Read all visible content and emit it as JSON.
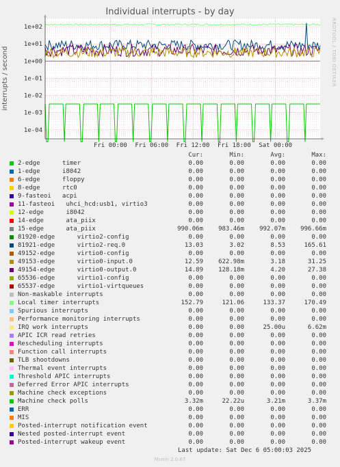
{
  "title": "Individual interrupts - by day",
  "side_label": "RRDTOOL / TOBI OETIKER",
  "ylabel": "interrupts / second",
  "headers": {
    "cur": "Cur:",
    "min": "Min:",
    "avg": "Avg:",
    "max": "Max:"
  },
  "legend": [
    {
      "name": "2-edge      timer",
      "color": "#00cc00",
      "cur": "0.00",
      "min": "0.00",
      "avg": "0.00",
      "max": "0.00"
    },
    {
      "name": "1-edge      i8042",
      "color": "#0066b3",
      "cur": "0.00",
      "min": "0.00",
      "avg": "0.00",
      "max": "0.00"
    },
    {
      "name": "6-edge      floppy",
      "color": "#ff8000",
      "cur": "0.00",
      "min": "0.00",
      "avg": "0.00",
      "max": "0.00"
    },
    {
      "name": "8-edge      rtc0",
      "color": "#ffcc00",
      "cur": "0.00",
      "min": "0.00",
      "avg": "0.00",
      "max": "0.00"
    },
    {
      "name": "9-fasteoi   acpi",
      "color": "#330099",
      "cur": "0.00",
      "min": "0.00",
      "avg": "0.00",
      "max": "0.00"
    },
    {
      "name": "11-fasteoi   uhci_hcd:usb1, virtio3",
      "color": "#990099",
      "cur": "0.00",
      "min": "0.00",
      "avg": "0.00",
      "max": "0.00"
    },
    {
      "name": "12-edge      i8042",
      "color": "#ccff00",
      "cur": "0.00",
      "min": "0.00",
      "avg": "0.00",
      "max": "0.00"
    },
    {
      "name": "14-edge      ata_piix",
      "color": "#ff0000",
      "cur": "0.00",
      "min": "0.00",
      "avg": "0.00",
      "max": "0.00"
    },
    {
      "name": "15-edge      ata_piix",
      "color": "#808080",
      "cur": "990.06m",
      "min": "983.46m",
      "avg": "992.07m",
      "max": "996.66m"
    },
    {
      "name": "81920-edge      virtio2-config",
      "color": "#008f00",
      "cur": "0.00",
      "min": "0.00",
      "avg": "0.00",
      "max": "0.00"
    },
    {
      "name": "81921-edge      virtio2-req.0",
      "color": "#00487d",
      "cur": "13.03",
      "min": "3.02",
      "avg": "8.53",
      "max": "165.61"
    },
    {
      "name": "49152-edge      virtio0-config",
      "color": "#b35a00",
      "cur": "0.00",
      "min": "0.00",
      "avg": "0.00",
      "max": "0.00"
    },
    {
      "name": "49153-edge      virtio0-input.0",
      "color": "#b38f00",
      "cur": "12.59",
      "min": "622.98m",
      "avg": "3.18",
      "max": "31.25"
    },
    {
      "name": "49154-edge      virtio0-output.0",
      "color": "#6b006b",
      "cur": "14.89",
      "min": "128.18m",
      "avg": "4.20",
      "max": "27.38"
    },
    {
      "name": "65536-edge      virtio1-config",
      "color": "#8fb300",
      "cur": "0.00",
      "min": "0.00",
      "avg": "0.00",
      "max": "0.00"
    },
    {
      "name": "65537-edge      virtio1-virtqueues",
      "color": "#b30000",
      "cur": "0.00",
      "min": "0.00",
      "avg": "0.00",
      "max": "0.00"
    },
    {
      "name": "Non-maskable interrupts",
      "color": "#bebebe",
      "cur": "0.00",
      "min": "0.00",
      "avg": "0.00",
      "max": "0.00"
    },
    {
      "name": "Local timer interrupts",
      "color": "#80ff80",
      "cur": "152.79",
      "min": "121.06",
      "avg": "133.37",
      "max": "170.49"
    },
    {
      "name": "Spurious interrupts",
      "color": "#80c9ff",
      "cur": "0.00",
      "min": "0.00",
      "avg": "0.00",
      "max": "0.00"
    },
    {
      "name": "Performance monitoring interrupts",
      "color": "#ffc080",
      "cur": "0.00",
      "min": "0.00",
      "avg": "0.00",
      "max": "0.00"
    },
    {
      "name": "IRQ work interrupts",
      "color": "#ffe680",
      "cur": "0.00",
      "min": "0.00",
      "avg": "25.00u",
      "max": "6.62m"
    },
    {
      "name": "APIC ICR read retries",
      "color": "#aa80ff",
      "cur": "0.00",
      "min": "0.00",
      "avg": "0.00",
      "max": "0.00"
    },
    {
      "name": "Rescheduling interrupts",
      "color": "#ee00cc",
      "cur": "0.00",
      "min": "0.00",
      "avg": "0.00",
      "max": "0.00"
    },
    {
      "name": "Function call interrupts",
      "color": "#ff8080",
      "cur": "0.00",
      "min": "0.00",
      "avg": "0.00",
      "max": "0.00"
    },
    {
      "name": "TLB shootdowns",
      "color": "#666600",
      "cur": "0.00",
      "min": "0.00",
      "avg": "0.00",
      "max": "0.00"
    },
    {
      "name": "Thermal event interrupts",
      "color": "#ffbfff",
      "cur": "0.00",
      "min": "0.00",
      "avg": "0.00",
      "max": "0.00"
    },
    {
      "name": "Threshold APIC interrupts",
      "color": "#00ffcc",
      "cur": "0.00",
      "min": "0.00",
      "avg": "0.00",
      "max": "0.00"
    },
    {
      "name": "Deferred Error APIC interrupts",
      "color": "#cc6699",
      "cur": "0.00",
      "min": "0.00",
      "avg": "0.00",
      "max": "0.00"
    },
    {
      "name": "Machine check exceptions",
      "color": "#999900",
      "cur": "0.00",
      "min": "0.00",
      "avg": "0.00",
      "max": "0.00"
    },
    {
      "name": "Machine check polls",
      "color": "#00cc00",
      "cur": "3.32m",
      "min": "22.22u",
      "avg": "3.21m",
      "max": "3.37m"
    },
    {
      "name": "ERR",
      "color": "#0066b3",
      "cur": "0.00",
      "min": "0.00",
      "avg": "0.00",
      "max": "0.00"
    },
    {
      "name": "MIS",
      "color": "#ff8000",
      "cur": "0.00",
      "min": "0.00",
      "avg": "0.00",
      "max": "0.00"
    },
    {
      "name": "Posted-interrupt notification event",
      "color": "#ffcc00",
      "cur": "0.00",
      "min": "0.00",
      "avg": "0.00",
      "max": "0.00"
    },
    {
      "name": "Nested posted-interrupt event",
      "color": "#330099",
      "cur": "0.00",
      "min": "0.00",
      "avg": "0.00",
      "max": "0.00"
    },
    {
      "name": "Posted-interrupt wakeup event",
      "color": "#990099",
      "cur": "0.00",
      "min": "0.00",
      "avg": "0.00",
      "max": "0.00"
    }
  ],
  "last_update": "Last update: Sat Dec  6 05:00:03 2025",
  "munin_version": "Munin 2.0.67",
  "chart_data": {
    "type": "line",
    "title": "Individual interrupts - by day",
    "ylabel": "interrupts / second",
    "yscale": "log",
    "ylim": [
      3e-05,
      300
    ],
    "yticks": [
      {
        "label": "1e+02",
        "value": 100
      },
      {
        "label": "1e+01",
        "value": 10
      },
      {
        "label": "1e+00",
        "value": 1
      },
      {
        "label": "1e-01",
        "value": 0.1
      },
      {
        "label": "1e-02",
        "value": 0.01
      },
      {
        "label": "1e-03",
        "value": 0.001
      },
      {
        "label": "1e-04",
        "value": 0.0001
      }
    ],
    "xlim_hours": [
      -9.5,
      30.5
    ],
    "xticks": [
      {
        "label": "Fri 00:00",
        "hour": 0
      },
      {
        "label": "Fri 06:00",
        "hour": 6
      },
      {
        "label": "Fri 12:00",
        "hour": 12
      },
      {
        "label": "Fri 18:00",
        "hour": 18
      },
      {
        "label": "Sat 00:00",
        "hour": 24
      }
    ],
    "grid": true,
    "series": [
      {
        "name": "Local timer interrupts",
        "color": "#80ff80",
        "base": 133.37,
        "jitter": 0.05
      },
      {
        "name": "81921-edge      virtio2-req.0",
        "color": "#00487d",
        "base": 8.53,
        "jitter": 0.3,
        "spike_at_hour": 28.5,
        "spike_value": 165.61
      },
      {
        "name": "49154-edge      virtio0-output.0",
        "color": "#6b006b",
        "base": 4.2,
        "jitter": 0.35
      },
      {
        "name": "49153-edge      virtio0-input.0",
        "color": "#b38f00",
        "base": 3.18,
        "jitter": 0.3
      },
      {
        "name": "15-edge      ata_piix",
        "color": "#808080",
        "base": 0.992,
        "jitter": 0.002
      },
      {
        "name": "Machine check polls",
        "color": "#00cc00",
        "base": 0.00321,
        "dips_every_hours": 2.5,
        "dip_value": 2e-05
      }
    ]
  }
}
